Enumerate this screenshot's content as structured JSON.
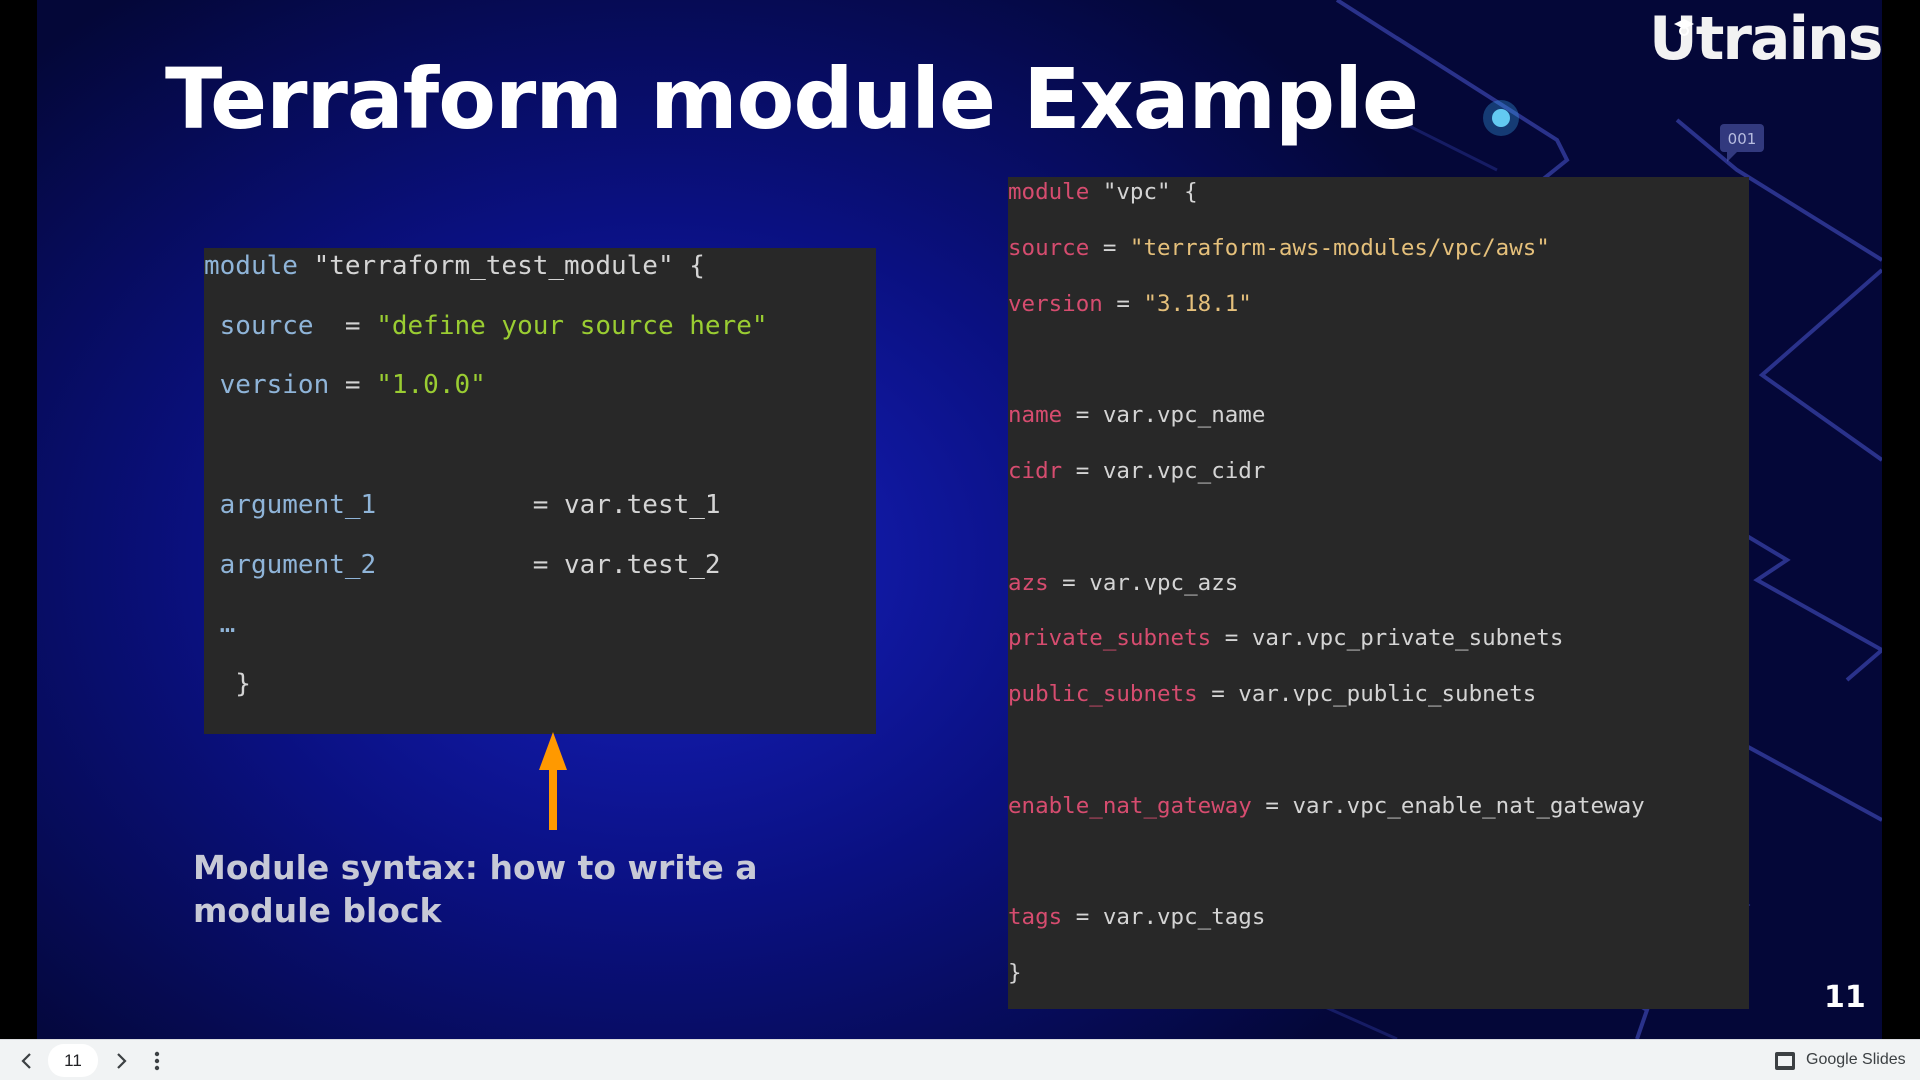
{
  "slide": {
    "title": "Terraform module Example",
    "logo_text": "Utrains",
    "badge_text": "001",
    "caption": "Module syntax: how to write a module block",
    "slide_number": "11",
    "colors": {
      "background_center": "#1a20c0",
      "background_edge": "#040738",
      "code_background": "#282828",
      "keyword_blue": "#8fb4d8",
      "keyword_red": "#d64c6f",
      "string_green": "#9acd32",
      "string_gold": "#e5c07b",
      "arrow": "#ff9900"
    }
  },
  "code_left": {
    "lines": [
      [
        {
          "t": "module",
          "c": "kw-blue"
        },
        {
          "t": " \"terraform_test_module\" {",
          "c": "plain"
        }
      ],
      [
        {
          "t": " source",
          "c": "kw-blue"
        },
        {
          "t": "  = ",
          "c": "plain"
        },
        {
          "t": "\"define your source here\"",
          "c": "str-green"
        }
      ],
      [
        {
          "t": " version",
          "c": "kw-blue"
        },
        {
          "t": " = ",
          "c": "plain"
        },
        {
          "t": "\"1.0.0\"",
          "c": "str-green"
        }
      ],
      [],
      [
        {
          "t": " argument_1",
          "c": "kw-blue"
        },
        {
          "t": "          = var.test_1",
          "c": "plain"
        }
      ],
      [
        {
          "t": " argument_2",
          "c": "kw-blue"
        },
        {
          "t": "          = var.test_2",
          "c": "plain"
        }
      ],
      [
        {
          "t": " …",
          "c": "kw-blue"
        }
      ],
      [
        {
          "t": "  }",
          "c": "plain"
        }
      ]
    ]
  },
  "code_right": {
    "lines": [
      [
        {
          "t": "module",
          "c": "kw-red"
        },
        {
          "t": " \"vpc\" {",
          "c": "plain"
        }
      ],
      [
        {
          "t": "source",
          "c": "kw-red"
        },
        {
          "t": " = ",
          "c": "plain"
        },
        {
          "t": "\"terraform-aws-modules/vpc/aws\"",
          "c": "str-gold"
        }
      ],
      [
        {
          "t": "version",
          "c": "kw-red"
        },
        {
          "t": " = ",
          "c": "plain"
        },
        {
          "t": "\"3.18.1\"",
          "c": "str-gold"
        }
      ],
      [],
      [
        {
          "t": "name",
          "c": "kw-red"
        },
        {
          "t": " = var.vpc_name",
          "c": "plain"
        }
      ],
      [
        {
          "t": "cidr",
          "c": "kw-red"
        },
        {
          "t": " = var.vpc_cidr",
          "c": "plain"
        }
      ],
      [],
      [
        {
          "t": "azs",
          "c": "kw-red"
        },
        {
          "t": " = var.vpc_azs",
          "c": "plain"
        }
      ],
      [
        {
          "t": "private_subnets",
          "c": "kw-red"
        },
        {
          "t": " = var.vpc_private_subnets",
          "c": "plain"
        }
      ],
      [
        {
          "t": "public_subnets",
          "c": "kw-red"
        },
        {
          "t": " = var.vpc_public_subnets",
          "c": "plain"
        }
      ],
      [],
      [
        {
          "t": "enable_nat_gateway",
          "c": "kw-red"
        },
        {
          "t": " = var.vpc_enable_nat_gateway",
          "c": "plain"
        }
      ],
      [],
      [
        {
          "t": "tags",
          "c": "kw-red"
        },
        {
          "t": " = var.vpc_tags",
          "c": "plain"
        }
      ],
      [
        {
          "t": "}",
          "c": "plain"
        }
      ]
    ]
  },
  "bottom_bar": {
    "current_page": "11",
    "product_name": "Google Slides",
    "icons": [
      "chevron-left-icon",
      "chevron-right-icon",
      "more-vert-icon",
      "slides-logo-icon"
    ]
  }
}
